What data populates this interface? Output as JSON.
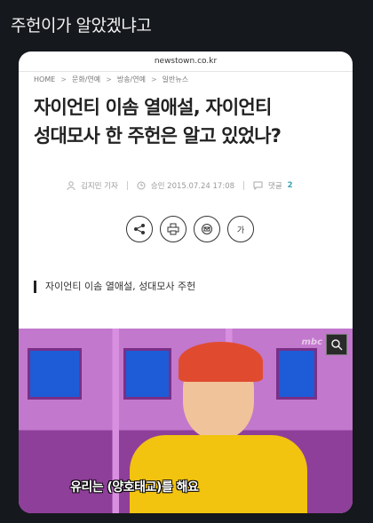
{
  "post": {
    "caption": "주헌이가 알았겠냐고"
  },
  "article": {
    "domain": "newstown.co.kr",
    "breadcrumb": [
      "HOME",
      "문화/연예",
      "방송/연예",
      "일반뉴스"
    ],
    "headline_line1": "자이언티 이솜 열애설, 자이언티",
    "headline_line2": "성대모사 한 주헌은 알고 있었나?",
    "author": "김지민 기자",
    "approved": "승인 2015.07.24 17:08",
    "comments_label": "댓글",
    "comments_count": "2",
    "actions": [
      "share",
      "print",
      "email",
      "font-size"
    ],
    "font_size_label": "가",
    "summary": "자이언티 이솜 열애설, 성대모사 주헌",
    "video_subtitle": "유리는 (양호태교)를 해요",
    "video_logo": "mbc"
  },
  "colors": {
    "background": "#15181c",
    "card": "#ffffff",
    "accent": "#3aa3b5"
  }
}
